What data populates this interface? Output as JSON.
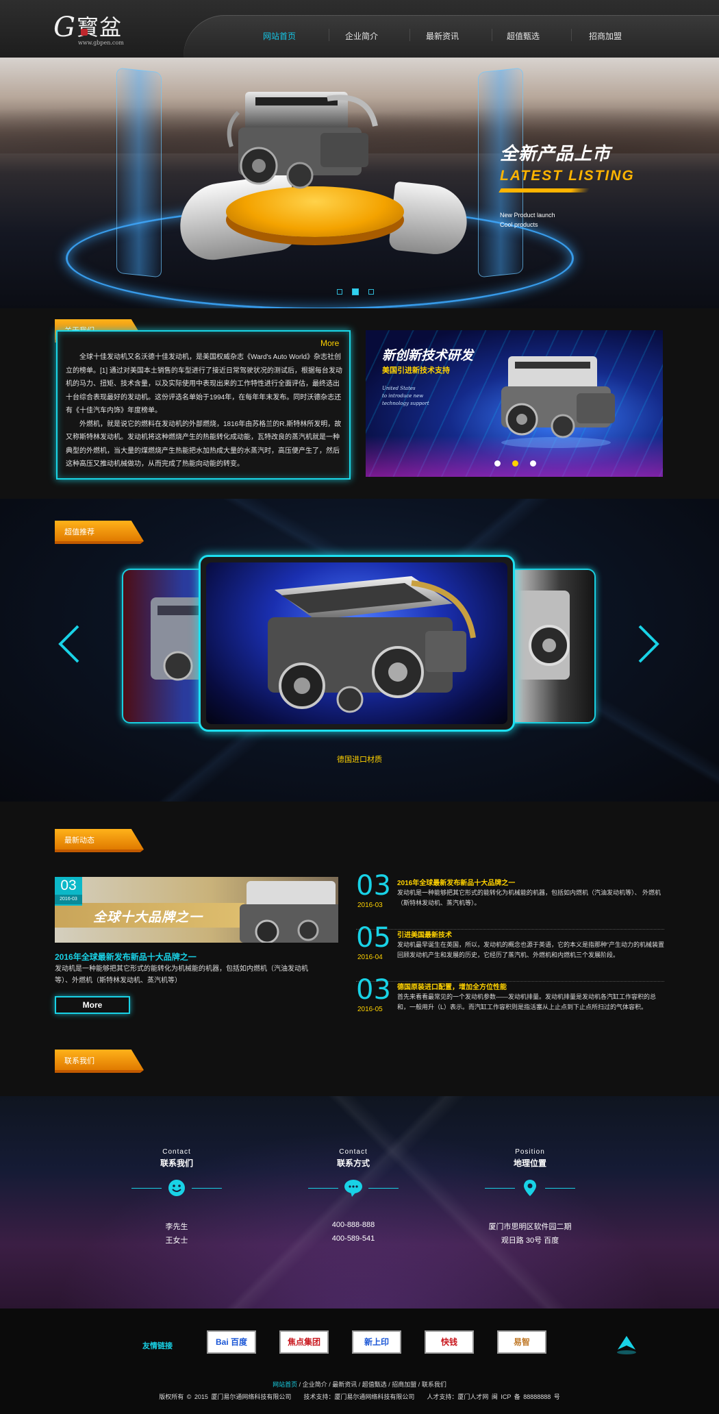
{
  "logo": {
    "letter": "G",
    "name": "寳盆",
    "url": "www.gbpen.com"
  },
  "nav": [
    {
      "label": "网站首页",
      "active": true
    },
    {
      "label": "企业简介",
      "active": false
    },
    {
      "label": "最新资讯",
      "active": false
    },
    {
      "label": "超值甄选",
      "active": false
    },
    {
      "label": "招商加盟",
      "active": false
    }
  ],
  "hero": {
    "title_cn": "全新产品上市",
    "title_en": "LATEST LISTING",
    "sub_line1": "New Product launch",
    "sub_line2": "Cool products",
    "slide_count": 3,
    "active_slide": 2
  },
  "about": {
    "tag": "关于我们",
    "more": "More",
    "para1": "全球十佳发动机又名沃德十佳发动机，是美国权威杂志《Ward's Auto World》杂志社创立的榜单。[1] 通过对美国本土销售的车型进行了接近日常驾驶状况的测试后，根据每台发动机的马力、扭矩、技术含量，以及实际使用中表现出来的工作特性进行全面评估，最终选出十台综合表现最好的发动机。这份评选名单始于1994年，在每年年末发布。同时沃德杂志还有《十佳汽车内饰》年度榜单。",
    "para2": "外燃机，就是说它的燃料在发动机的外部燃烧，1816年由苏格兰的R.斯特林所发明，故又称斯特林发动机。发动机将这种燃烧产生的热能转化成动能，瓦特改良的蒸汽机就是一种典型的外燃机，当大量的煤燃烧产生热能把水加热成大量的水蒸汽时，高压便产生了，然后这种高压又推动机械做功，从而完成了热能向动能的转变。",
    "pic_title": "新创新技术研发",
    "pic_sub": "美国引进新技术支持",
    "pic_en1": "United States",
    "pic_en2": "to introduce new",
    "pic_en3": "technology support",
    "pic_dot_count": 3,
    "pic_active_dot": 2
  },
  "recommend": {
    "tag": "超值推荐",
    "caption": "德国进口材质"
  },
  "news": {
    "tag": "最新动态",
    "feature": {
      "day": "03",
      "month": "2016-03",
      "banner": "全球十大品牌之一",
      "title": "2016年全球最新发布新品十大品牌之一",
      "desc": "发动机是一种能够把其它形式的能转化为机械能的机器，包括如内燃机（汽油发动机等）、外燃机（斯特林发动机、蒸汽机等）",
      "more": "More"
    },
    "items": [
      {
        "day": "03",
        "date": "2016-03",
        "title": "2016年全球最新发布新品十大品牌之一",
        "text": "发动机是一种能够把其它形式的能转化为机械能的机器，包括如内燃机（汽油发动机等）、 外燃机（斯特林发动机、蒸汽机等）。"
      },
      {
        "day": "05",
        "date": "2016-04",
        "title": "引进美国最新技术",
        "text": "发动机最早诞生在英国，所以，发动机的概念也源于英语，它的本义是指那种“产生动力的机械装置回顾发动机产生和发展的历史，它经历了蒸汽机、外燃机和内燃机三个发展阶段。"
      },
      {
        "day": "03",
        "date": "2016-05",
        "title": "德国原装进口配置，增加全方位性能",
        "text": "首先来看看最常见的一个发动机参数——发动机排量。发动机排量是发动机各汽缸工作容积的总和，一般用升（L）表示。而汽缸工作容积则是指活塞从上止点到下止点所扫过的气体容积。"
      }
    ]
  },
  "contact": {
    "tag": "联系我们",
    "cols": [
      {
        "en": "Contact",
        "cn": "联系我们",
        "icon": "smiley-icon",
        "v1": "李先生",
        "v2": "王女士"
      },
      {
        "en": "Contact",
        "cn": "联系方式",
        "icon": "chat-bubble-icon",
        "v1": "400-888-888",
        "v2": "400-589-541"
      },
      {
        "en": "Position",
        "cn": "地理位置",
        "icon": "location-pin-icon",
        "v1": "厦门市思明区软件园二期",
        "v2": "观日路 30号 百度"
      }
    ]
  },
  "footer": {
    "friend_label": "友情链接",
    "friend_links": [
      {
        "label": "Bai 百度",
        "color": "#1a56d6"
      },
      {
        "label": "焦点集团",
        "color": "#c8161d"
      },
      {
        "label": "新上印",
        "color": "#1a56d6"
      },
      {
        "label": "快钱",
        "color": "#c8161d"
      },
      {
        "label": "易智",
        "color": "#c07a2a"
      }
    ],
    "links": [
      "网站首页",
      "企业简介",
      "最新资讯",
      "超值甄选",
      "招商加盟",
      "联系我们"
    ],
    "copyright": "版权所有 © 2015 厦门易尔通网络科技有限公司　　技术支持：厦门易尔通网络科技有限公司　　人才支持：厦门人才网 闽 ICP 备 88888888 号"
  },
  "colors": {
    "accent": "#19d2e6",
    "highlight": "#ffd200",
    "tag": "#f08a00"
  }
}
